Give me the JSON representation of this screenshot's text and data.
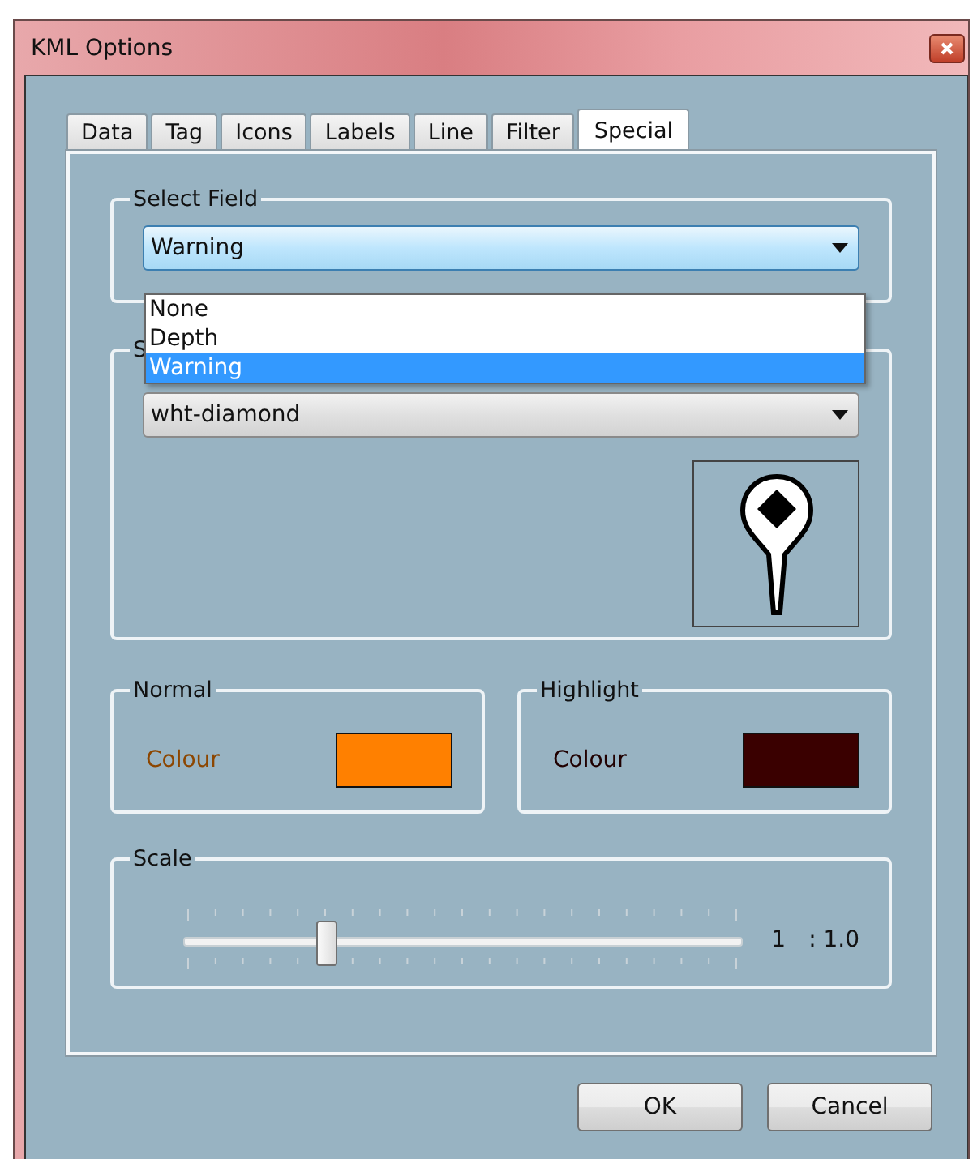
{
  "window": {
    "title": "KML Options"
  },
  "tabs": [
    {
      "label": "Data",
      "selected": false
    },
    {
      "label": "Tag",
      "selected": false
    },
    {
      "label": "Icons",
      "selected": false
    },
    {
      "label": "Labels",
      "selected": false
    },
    {
      "label": "Line",
      "selected": false
    },
    {
      "label": "Filter",
      "selected": false
    },
    {
      "label": "Special",
      "selected": true
    }
  ],
  "select_field": {
    "title": "Select Field",
    "value": "Warning",
    "options": [
      {
        "label": "None",
        "selected": false
      },
      {
        "label": "Depth",
        "selected": false
      },
      {
        "label": "Warning",
        "selected": true
      }
    ]
  },
  "symbol_group": {
    "title": "S",
    "value": "wht-diamond"
  },
  "colour_panels": [
    {
      "title": "Normal",
      "label": "Colour",
      "color": "#ff8000"
    },
    {
      "title": "Highlight",
      "label": "Colour",
      "color": "#3a0000"
    }
  ],
  "scale": {
    "title": "Scale",
    "level": 0.255,
    "value": "1",
    "ratio": ": 1.0"
  },
  "buttons": [
    "OK",
    "Cancel"
  ]
}
